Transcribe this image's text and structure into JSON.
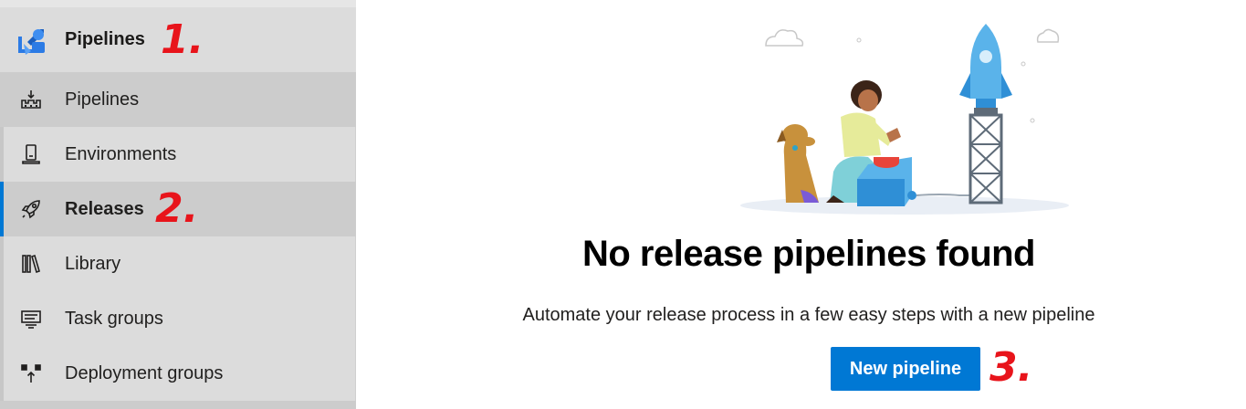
{
  "sidebar": {
    "hub": {
      "title": "Pipelines",
      "icon": "pipelines-logo-icon"
    },
    "items": [
      {
        "label": "Pipelines",
        "icon": "pipelines-icon"
      },
      {
        "label": "Environments",
        "icon": "environments-icon"
      },
      {
        "label": "Releases",
        "icon": "rocket-icon"
      },
      {
        "label": "Library",
        "icon": "library-icon"
      },
      {
        "label": "Task groups",
        "icon": "task-groups-icon"
      },
      {
        "label": "Deployment groups",
        "icon": "deployment-groups-icon"
      }
    ]
  },
  "annotations": {
    "one": "1.",
    "two": "2.",
    "three": "3."
  },
  "main": {
    "title": "No release pipelines found",
    "subtitle": "Automate your release process in a few easy steps with a new pipeline",
    "button_label": "New pipeline"
  },
  "colors": {
    "accent": "#0078d4",
    "annotation": "#e8141b",
    "sidebar_bg": "#dcdcdc"
  }
}
